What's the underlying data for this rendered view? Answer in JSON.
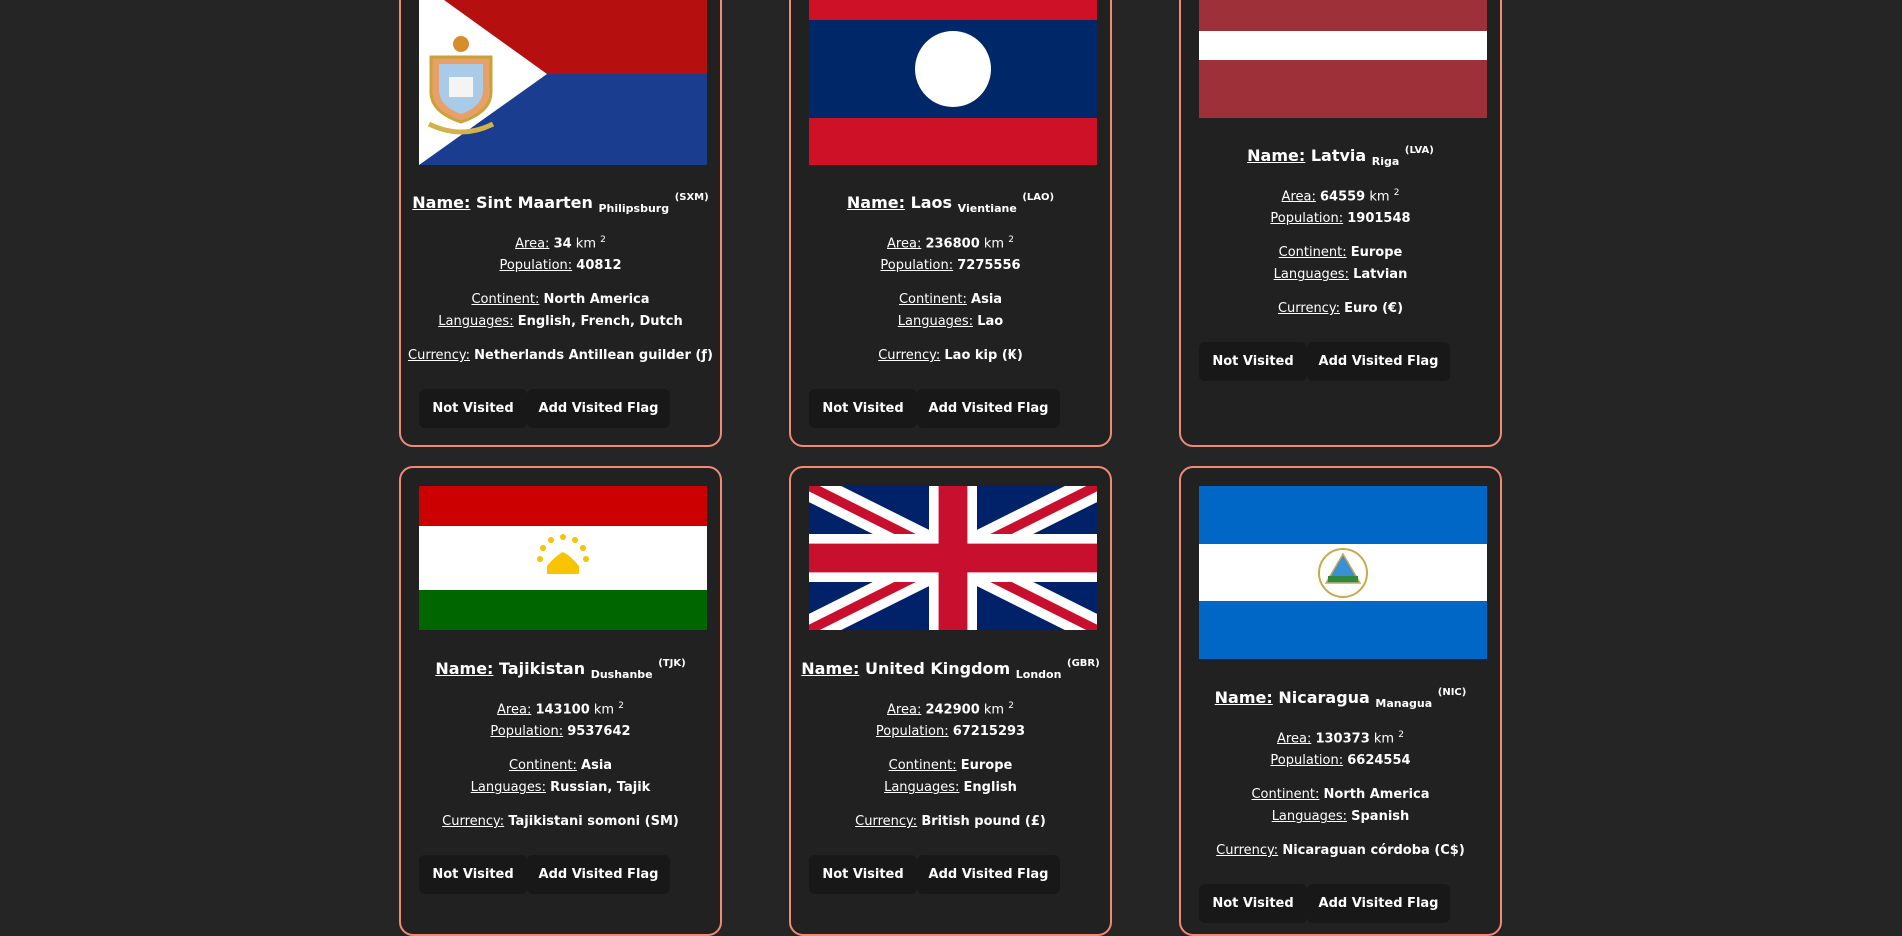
{
  "labels": {
    "name": "Name:",
    "area": "Area:",
    "population": "Population:",
    "continent": "Continent:",
    "languages": "Languages:",
    "currency": "Currency:",
    "area_unit": "km",
    "area_exp": "2",
    "not_visited": "Not Visited",
    "add_visited_flag": "Add Visited Flag"
  },
  "countries": [
    {
      "name": "Sint Maarten",
      "capital": "Philipsburg",
      "code": "(SXM)",
      "area": "34",
      "population": "40812",
      "continent": "North America",
      "languages": "English, French, Dutch",
      "currency": "Netherlands Antillean guilder (ƒ)"
    },
    {
      "name": "Laos",
      "capital": "Vientiane",
      "code": "(LAO)",
      "area": "236800",
      "population": "7275556",
      "continent": "Asia",
      "languages": "Lao",
      "currency": "Lao kip (₭)"
    },
    {
      "name": "Latvia",
      "capital": "Riga",
      "code": "(LVA)",
      "area": "64559",
      "population": "1901548",
      "continent": "Europe",
      "languages": "Latvian",
      "currency": "Euro (€)"
    },
    {
      "name": "Tajikistan",
      "capital": "Dushanbe",
      "code": "(TJK)",
      "area": "143100",
      "population": "9537642",
      "continent": "Asia",
      "languages": "Russian, Tajik",
      "currency": "Tajikistani somoni (SM)"
    },
    {
      "name": "United Kingdom",
      "capital": "London",
      "code": "(GBR)",
      "area": "242900",
      "population": "67215293",
      "continent": "Europe",
      "languages": "English",
      "currency": "British pound (£)"
    },
    {
      "name": "Nicaragua",
      "capital": "Managua",
      "code": "(NIC)",
      "area": "130373",
      "population": "6624554",
      "continent": "North America",
      "languages": "Spanish",
      "currency": "Nicaraguan córdoba (C$)"
    }
  ],
  "colors": {
    "card_border": "#f08a75",
    "background": "#252525",
    "card_bg": "#212121",
    "button_bg": "#181818"
  }
}
